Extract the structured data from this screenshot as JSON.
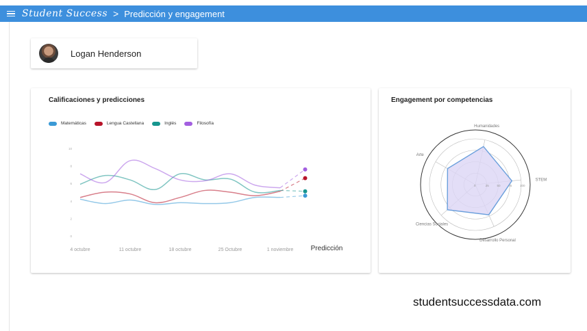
{
  "header": {
    "brand": "Student Success",
    "separator": ">",
    "breadcrumb": "Predicción y engagement"
  },
  "student": {
    "name": "Logan Henderson"
  },
  "grades_chart": {
    "title": "Calificaciones y predicciones",
    "prediction_label": "Predicción"
  },
  "radar": {
    "title": "Engagement por competencias"
  },
  "watermark": "studentsuccessdata.com",
  "colors": {
    "topbar": "#3d8fdd",
    "matematicas": "#3b9ad6",
    "lengua": "#b8142a",
    "ingles": "#17968f",
    "filosofia": "#a35fe0",
    "radar_fill": "#dcd6f5",
    "radar_stroke": "#6a9fdc"
  },
  "chart_data": [
    {
      "type": "line",
      "title": "Calificaciones y predicciones",
      "categories": [
        "4 octubre",
        "11 octubre",
        "18 octubre",
        "25 Octubre",
        "1 noviembre"
      ],
      "x_extra_label": "Predicción",
      "y_ticks": [
        0,
        2,
        4,
        6,
        8,
        10
      ],
      "ylim": [
        0,
        10
      ],
      "grid": false,
      "legend_position": "top-left",
      "x": [
        0,
        0.5,
        1,
        1.5,
        2,
        2.5,
        3,
        3.5,
        4,
        4.5
      ],
      "series": [
        {
          "name": "Matemáticas",
          "color": "#3b9ad6",
          "values": [
            4.2,
            3.7,
            4.1,
            3.6,
            3.8,
            3.7,
            3.8,
            4.4,
            4.4
          ],
          "prediction": 4.6
        },
        {
          "name": "Lengua Castellana",
          "color": "#b8142a",
          "values": [
            4.4,
            5.0,
            4.8,
            3.8,
            4.4,
            5.2,
            5.0,
            4.6,
            5.1
          ],
          "prediction": 6.6
        },
        {
          "name": "Inglés",
          "color": "#17968f",
          "values": [
            5.9,
            6.9,
            6.4,
            5.3,
            7.1,
            6.4,
            6.5,
            5.0,
            5.2
          ],
          "prediction": 5.1
        },
        {
          "name": "Filosofía",
          "color": "#a35fe0",
          "values": [
            7.1,
            6.1,
            8.6,
            7.7,
            6.4,
            6.3,
            7.1,
            5.8,
            5.5
          ],
          "prediction": 7.6
        }
      ]
    },
    {
      "type": "radar",
      "title": "Engagement por competencias",
      "axes": [
        "Humanidades",
        "STEM",
        "Desarrollo Personal",
        "Ciencias Sociales",
        "Arte"
      ],
      "ticks": [
        0,
        25,
        50,
        75,
        100
      ],
      "range": [
        0,
        100
      ],
      "values": [
        85,
        80,
        72,
        82,
        70
      ]
    }
  ]
}
